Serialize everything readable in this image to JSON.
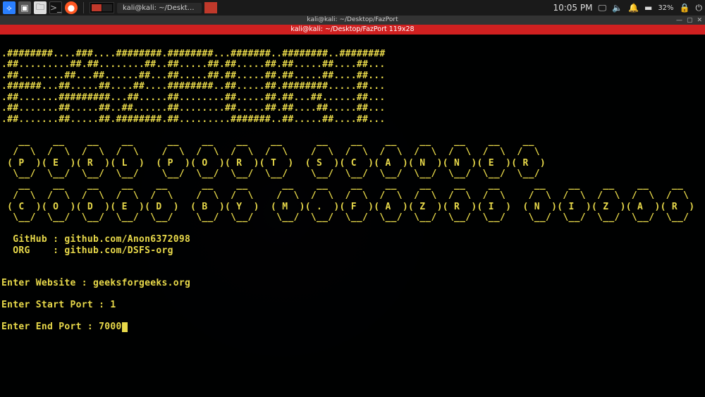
{
  "taskbar": {
    "task_label": "kali@kali: ~/Desktop/Fa...",
    "time": "10:05 PM",
    "battery": "32%"
  },
  "window": {
    "title_top": "kali@kali: ~/Desktop/FazPort",
    "title_sub": "kali@kali: ~/Desktop/FazPort 119x28"
  },
  "banner": {
    "l1": ".########....###....########.########...#######..########..########",
    "l2": ".##.........##.##........##..##.....##.##.....##.##.....##....##...",
    "l3": ".##........##...##......##...##.....##.##.....##.##.....##....##...",
    "l4": ".######...##.....##....##....########..##.....##.########.....##...",
    "l5": ".##.......#########...##.....##........##.....##.##...##......##...",
    "l6": ".##.......##.....##..##......##........##.....##.##....##.....##...",
    "l7": ".##.......##.....##.########.##.........#######..##.....##....##...",
    "p1": "   __    __    __    __      __    __    __    __      __    __    __    __    __    __    __",
    "p2": "  /  \\  /  \\  /  \\  /  \\    /  \\  /  \\  /  \\  /  \\    /  \\  /  \\  /  \\  /  \\  /  \\  /  \\  /  \\",
    "p3": " ( P  )( E  )( R  )( L  )  ( P  )( O  )( R  )( T  )  ( S  )( C  )( A  )( N  )( N  )( E  )( R  )",
    "p4": "  \\__/  \\__/  \\__/  \\__/    \\__/  \\__/  \\__/  \\__/    \\__/  \\__/  \\__/  \\__/  \\__/  \\__/  \\__/",
    "c1": "   __    __    __    __    __      __    __      __    __    __    __    __    __    __      __    __    __    __    __",
    "c2": "  /  \\  /  \\  /  \\  /  \\  /  \\    /  \\  /  \\    /  \\  /  \\  /  \\  /  \\  /  \\  /  \\  /  \\    /  \\  /  \\  /  \\  /  \\  /  \\",
    "c3": " ( C  )( O  )( D  )( E  )( D  )  ( B  )( Y  )  ( M  )( .  )( F  )( A  )( Z  )( R  )( I  )  ( N  )( I  )( Z  )( A  )( R  )",
    "c4": "  \\__/  \\__/  \\__/  \\__/  \\__/    \\__/  \\__/    \\__/  \\__/  \\__/  \\__/  \\__/  \\__/  \\__/    \\__/  \\__/  \\__/  \\__/  \\__/"
  },
  "info": {
    "github_line": "  GitHub : github.com/Anon6372098",
    "org_line": "  ORG    : github.com/DSFS-org"
  },
  "prompts": {
    "website_label": "Enter Website : ",
    "website_value": "geeksforgeeks.org",
    "start_label": "Enter Start Port : ",
    "start_value": "1",
    "end_label": "Enter End Port : ",
    "end_value": "7000"
  }
}
